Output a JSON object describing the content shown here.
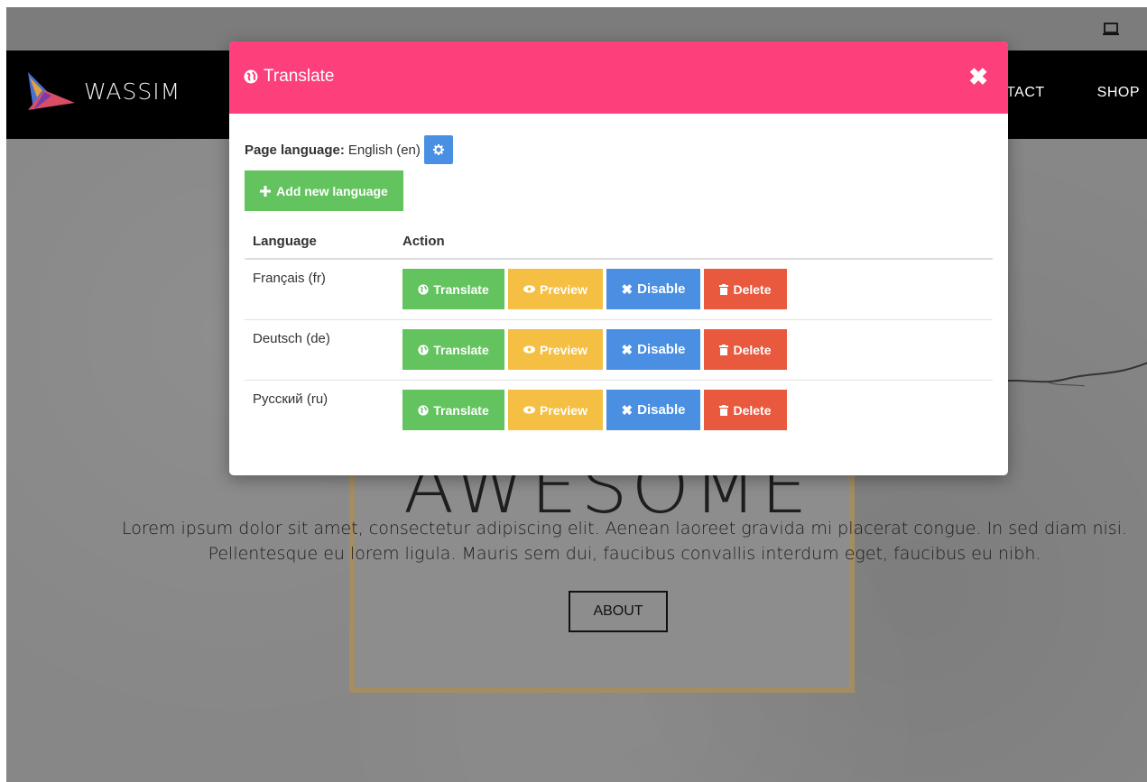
{
  "brand": {
    "name": "WASSIM"
  },
  "nav": {
    "items": [
      "TACT",
      "SHOP"
    ]
  },
  "hero": {
    "big_word": "AWESOME",
    "paragraph_line1": "Lorem ipsum dolor sit amet, consectetur adipiscing elit. Aenean laoreet gravida mi placerat congue. In sed diam nisi.",
    "paragraph_line2": "Pellentesque eu lorem ligula. Mauris sem dui, faucibus convallis interdum eget, faucibus eu nibh.",
    "about_label": "ABOUT"
  },
  "modal": {
    "title": "Translate",
    "close_label": "✖",
    "page_language_label": "Page language:",
    "page_language_value": "English (en)",
    "add_language_label": "Add new language",
    "columns": {
      "language": "Language",
      "action": "Action"
    },
    "rows": [
      {
        "language": "Français (fr)"
      },
      {
        "language": "Deutsch (de)"
      },
      {
        "language": "Русский (ru)"
      }
    ],
    "actions": {
      "translate": "Translate",
      "preview": "Preview",
      "disable": "Disable",
      "delete": "Delete"
    }
  },
  "colors": {
    "modal_header": "#fd3f7c",
    "translate_btn": "#63c35f",
    "preview_btn": "#f4bf42",
    "disable_btn": "#4a8fe2",
    "delete_btn": "#e9593d",
    "gear_btn": "#4a90e2"
  },
  "icons": {
    "title": "globe-icon",
    "close": "close-icon",
    "gear": "gear-icon",
    "add": "plus-icon",
    "translate": "globe-icon",
    "preview": "eye-icon",
    "disable": "x-icon",
    "delete": "trash-icon",
    "device": "laptop-icon"
  }
}
